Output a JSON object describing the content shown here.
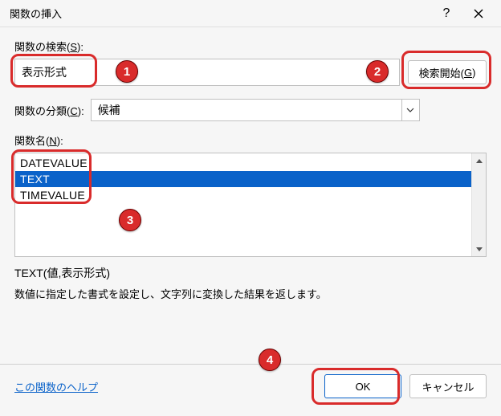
{
  "title": "関数の挿入",
  "search_label_pre": "関数の検索(",
  "search_label_u": "S",
  "search_label_post": "):",
  "search_value": "表示形式",
  "go_button_pre": "検索開始(",
  "go_button_u": "G",
  "go_button_post": ")",
  "category_label_pre": "関数の分類(",
  "category_label_u": "C",
  "category_label_post": "):",
  "category_value": "候補",
  "name_label_pre": "関数名(",
  "name_label_u": "N",
  "name_label_post": "):",
  "functions": {
    "0": "DATEVALUE",
    "1": "TEXT",
    "2": "TIMEVALUE"
  },
  "syntax": "TEXT(値,表示形式)",
  "description": "数値に指定した書式を設定し、文字列に変換した結果を返します。",
  "help_link": "この関数のヘルプ",
  "ok_label": "OK",
  "cancel_label": "キャンセル",
  "markers": {
    "m1": "1",
    "m2": "2",
    "m3": "3",
    "m4": "4"
  }
}
